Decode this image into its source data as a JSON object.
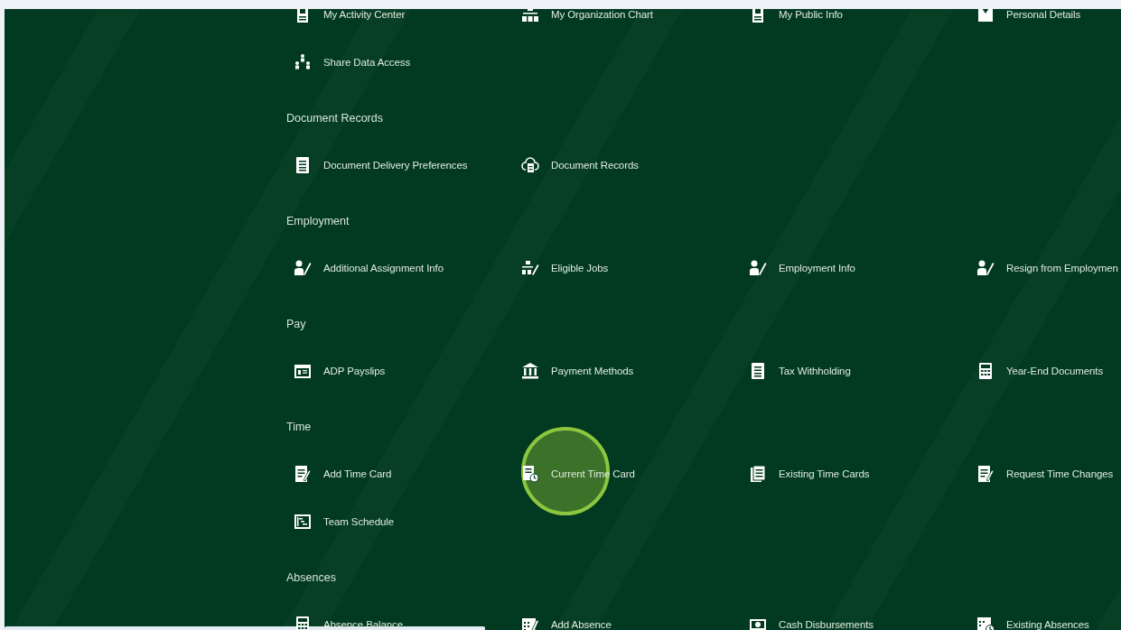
{
  "sections": [
    {
      "items": [
        {
          "label": "My Activity Center",
          "kind": "idcard"
        },
        {
          "label": "My Organization Chart",
          "kind": "org"
        },
        {
          "label": "My Public Info",
          "kind": "idcard"
        },
        {
          "label": "Personal Details",
          "kind": "profile"
        },
        {
          "label": "Share Data Access",
          "kind": "share"
        }
      ]
    },
    {
      "title": "Document Records",
      "items": [
        {
          "label": "Document Delivery Preferences",
          "kind": "doc"
        },
        {
          "label": "Document Records",
          "kind": "clouddoc"
        }
      ]
    },
    {
      "title": "Employment",
      "items": [
        {
          "label": "Additional Assignment Info",
          "kind": "personedit"
        },
        {
          "label": "Eligible Jobs",
          "kind": "orgedit"
        },
        {
          "label": "Employment Info",
          "kind": "personedit"
        },
        {
          "label": "Resign from Employmen",
          "kind": "personedit"
        }
      ]
    },
    {
      "title": "Pay",
      "items": [
        {
          "label": "ADP Payslips",
          "kind": "payslip"
        },
        {
          "label": "Payment Methods",
          "kind": "bank"
        },
        {
          "label": "Tax Withholding",
          "kind": "doc"
        },
        {
          "label": "Year-End Documents",
          "kind": "calc"
        }
      ]
    },
    {
      "title": "Time",
      "items": [
        {
          "label": "Add Time Card",
          "kind": "editdoc"
        },
        {
          "label": "Current Time Card",
          "kind": "docclock"
        },
        {
          "label": "Existing Time Cards",
          "kind": "docs"
        },
        {
          "label": "Request Time Changes",
          "kind": "editdoc"
        },
        {
          "label": "Team Schedule",
          "kind": "schedule"
        }
      ]
    },
    {
      "title": "Absences",
      "items": [
        {
          "label": "Absence Balance",
          "kind": "calc"
        },
        {
          "label": "Add Absence",
          "kind": "caledit"
        },
        {
          "label": "Cash Disbursements",
          "kind": "cash"
        },
        {
          "label": "Existing Absences",
          "kind": "calclock"
        }
      ]
    }
  ]
}
